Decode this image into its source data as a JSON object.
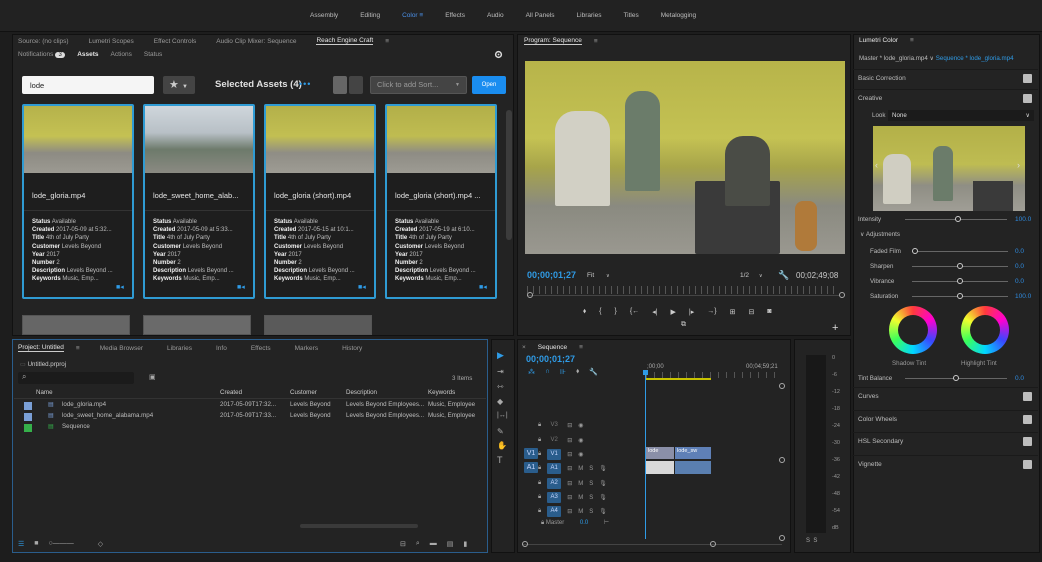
{
  "workspaces": [
    "Assembly",
    "Editing",
    "Color",
    "Effects",
    "Audio",
    "All Panels",
    "Libraries",
    "Titles",
    "Metalogging"
  ],
  "active_workspace": "Color",
  "source_tabs": [
    "Source: (no clips)",
    "Lumetri Scopes",
    "Effect Controls",
    "Audio Clip Mixer: Sequence",
    "Reach Engine Craft"
  ],
  "reach": {
    "subtabs": [
      "Notifications",
      "Assets",
      "Actions",
      "Status"
    ],
    "notif_count": "3",
    "search_value": "lode",
    "selected_label": "Selected Assets (4)",
    "sort_placeholder": "Click to add Sort...",
    "open_label": "Open",
    "assets": [
      {
        "title": "lode_gloria.mp4",
        "status": "Available",
        "created": "2017-05-09 at 5:32...",
        "title_meta": "4th of July Party",
        "customer": "Levels Beyond",
        "year": "2017",
        "number": "2",
        "description": "Levels Beyond ...",
        "keywords": "Music, Emp..."
      },
      {
        "title": "lode_sweet_home_alab...",
        "status": "Available",
        "created": "2017-05-09 at 5:33...",
        "title_meta": "4th of July Party",
        "customer": "Levels Beyond",
        "year": "2017",
        "number": "2",
        "description": "Levels Beyond ...",
        "keywords": "Music, Emp..."
      },
      {
        "title": "lode_gloria (short).mp4",
        "status": "Available",
        "created": "2017-05-15 at 10:1...",
        "title_meta": "4th of July Party",
        "customer": "Levels Beyond",
        "year": "2017",
        "number": "2",
        "description": "Levels Beyond ...",
        "keywords": "Music, Emp..."
      },
      {
        "title": "lode_gloria (short).mp4 ...",
        "status": "Available",
        "created": "2017-05-19 at 6:10...",
        "title_meta": "4th of July Party",
        "customer": "Levels Beyond",
        "year": "2017",
        "number": "2",
        "description": "Levels Beyond ...",
        "keywords": "Music, Emp..."
      }
    ],
    "meta_labels": {
      "status": "Status",
      "created": "Created",
      "title": "Title",
      "customer": "Customer",
      "year": "Year",
      "number": "Number",
      "description": "Description",
      "keywords": "Keywords"
    }
  },
  "program": {
    "tab": "Program: Sequence",
    "timecode": "00;00;01;27",
    "fit": "Fit",
    "resolution": "1/2",
    "duration": "00;02;49;08"
  },
  "project": {
    "tabs": [
      "Project: Untitled",
      "Media Browser",
      "Libraries",
      "Info",
      "Effects",
      "Markers",
      "History"
    ],
    "file": "Untitled.prproj",
    "items_count": "3 Items",
    "columns": [
      "Name",
      "Created",
      "Customer",
      "Description",
      "Keywords"
    ],
    "rows": [
      {
        "name": "lode_gloria.mp4",
        "created": "2017-05-09T17:32...",
        "customer": "Levels Beyond",
        "description": "Levels Beyond Employees...",
        "keywords": "Music, Employee",
        "color": "#7a9fd6"
      },
      {
        "name": "lode_sweet_home_alabama.mp4",
        "created": "2017-05-09T17:33...",
        "customer": "Levels Beyond",
        "description": "Levels Beyond Employees...",
        "keywords": "Music, Employee",
        "color": "#7a9fd6"
      },
      {
        "name": "Sequence",
        "created": "",
        "customer": "",
        "description": "",
        "keywords": "",
        "color": "#35b04a"
      }
    ]
  },
  "timeline": {
    "tab": "Sequence",
    "timecode": "00;00;01;27",
    "ruler_start": ";00;00",
    "ruler_end": "00;04;59;21",
    "video_tracks": [
      "V3",
      "V2",
      "V1"
    ],
    "audio_tracks": [
      "A1",
      "A2",
      "A3",
      "A4"
    ],
    "master_label": "Master",
    "master_value": "0.0",
    "clip_labels": [
      "lode",
      "lode_sw"
    ],
    "meter_labels": [
      "0",
      "-6",
      "-12",
      "-18",
      "-24",
      "-30",
      "-36",
      "-42",
      "-48",
      "-54",
      "dB"
    ],
    "meter_buttons": [
      "S",
      "S"
    ]
  },
  "lumetri": {
    "title": "Lumetri Color",
    "master": "Master * lode_gloria.mp4",
    "sequence": "Sequence * lode_gloria.mp4",
    "basic": "Basic Correction",
    "creative": "Creative",
    "look_label": "Look",
    "look_value": "None",
    "intensity_label": "Intensity",
    "intensity_value": "100.0",
    "adjustments": "Adjustments",
    "adj": [
      {
        "label": "Faded Film",
        "value": "0.0",
        "pos": 0.0
      },
      {
        "label": "Sharpen",
        "value": "0.0",
        "pos": 0.5
      },
      {
        "label": "Vibrance",
        "value": "0.0",
        "pos": 0.5
      },
      {
        "label": "Saturation",
        "value": "100.0",
        "pos": 0.5
      }
    ],
    "shadow_tint": "Shadow Tint",
    "highlight_tint": "Highlight Tint",
    "tint_balance_label": "Tint Balance",
    "tint_balance_value": "0.0",
    "sections": [
      "Curves",
      "Color Wheels",
      "HSL Secondary",
      "Vignette"
    ]
  }
}
